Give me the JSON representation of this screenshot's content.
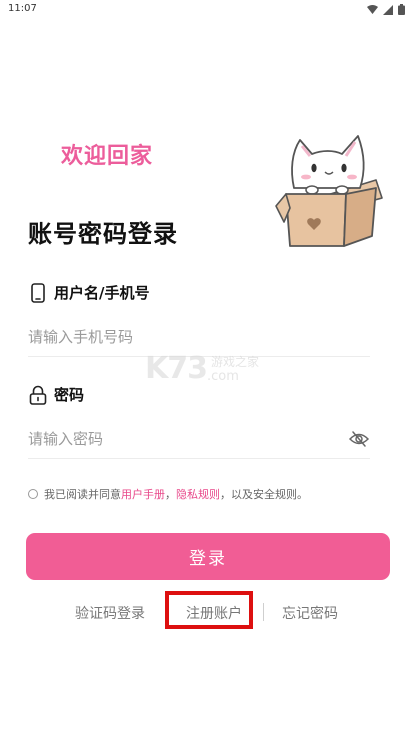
{
  "status_bar": {
    "time": "11:07",
    "icons": [
      "wifi-icon",
      "signal-icon",
      "battery-icon"
    ]
  },
  "header": {
    "welcome": "欢迎回家",
    "title": "账号密码登录"
  },
  "mascot": {
    "icon": "cat-in-box-icon"
  },
  "form": {
    "phone_label": "用户名/手机号",
    "phone_placeholder": "请输入手机号码",
    "password_label": "密码",
    "password_placeholder": "请输入密码"
  },
  "agreement": {
    "prefix": "我已阅读并同意",
    "user_manual": "用户手册",
    "comma": "，",
    "privacy": "隐私规则",
    "suffix": "，以及安全规则。"
  },
  "login_button": "登录",
  "links": {
    "sms_login": "验证码登录",
    "register": "注册账户",
    "forgot": "忘记密码"
  },
  "watermark": {
    "logo": "K73",
    "tagline": "游戏之家",
    "domain": ".com"
  },
  "colors": {
    "accent": "#f15d95",
    "welcome": "#ec5d9b",
    "highlight": "#dd1010"
  }
}
